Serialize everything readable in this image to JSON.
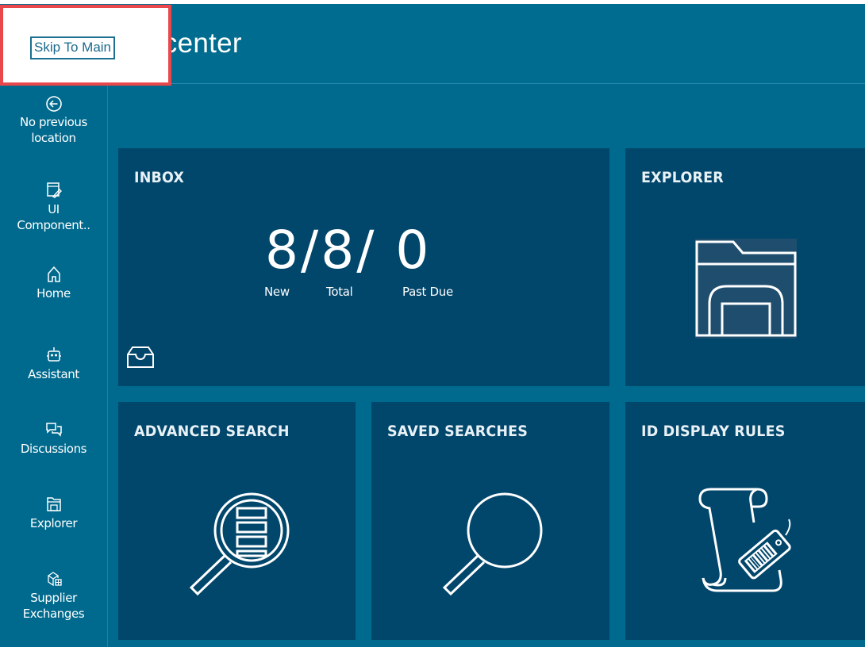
{
  "skip_link": "Skip To Main",
  "header": {
    "title": "ncenter"
  },
  "sidebar": {
    "items": [
      {
        "label_line1": "No previous",
        "label_line2": "location",
        "icon": "back-arrow-icon"
      },
      {
        "label_line1": "UI",
        "label_line2": "Component..",
        "icon": "ui-components-icon"
      },
      {
        "label_line1": "Home",
        "label_line2": "",
        "icon": "home-icon"
      },
      {
        "label_line1": "Assistant",
        "label_line2": "",
        "icon": "robot-icon"
      },
      {
        "label_line1": "Discussions",
        "label_line2": "",
        "icon": "chat-bubbles-icon"
      },
      {
        "label_line1": "Explorer",
        "label_line2": "",
        "icon": "folder-icon"
      },
      {
        "label_line1": "Supplier",
        "label_line2": "Exchanges",
        "icon": "supplier-exchange-icon"
      }
    ]
  },
  "tiles": {
    "inbox": {
      "title": "INBOX",
      "count": "8/8/ 0",
      "new_label": "New",
      "total_label": "Total",
      "past_due_label": "Past Due"
    },
    "explorer": {
      "title": "EXPLORER"
    },
    "advanced_search": {
      "title": "ADVANCED SEARCH"
    },
    "saved_searches": {
      "title": "SAVED SEARCHES"
    },
    "id_display_rules": {
      "title": "ID DISPLAY RULES"
    }
  },
  "colors": {
    "app_background": "#006a8e",
    "tile_background": "#01466b",
    "skip_box_border": "#e8484c",
    "text": "#ffffff"
  }
}
